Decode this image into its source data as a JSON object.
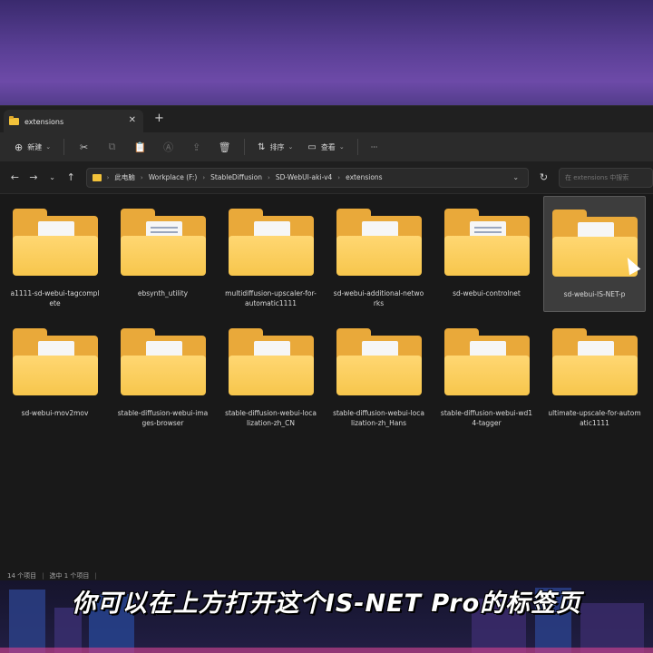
{
  "tab": {
    "title": "extensions",
    "close": "✕",
    "new": "+"
  },
  "toolbar": {
    "new_label": "新建",
    "sort_label": "排序",
    "view_label": "查看",
    "more": "···"
  },
  "address": {
    "crumbs": [
      "此电脑",
      "Workplace (F:)",
      "StableDiffusion",
      "SD-WebUI-aki-v4",
      "extensions"
    ],
    "search_placeholder": "在 extensions 中搜索"
  },
  "folders": [
    {
      "name": "a1111-sd-webui-tagcomplete",
      "line1": "a1111-sd-webui-tagcompl",
      "line2": "ete",
      "doc": false
    },
    {
      "name": "ebsynth_utility",
      "line1": "ebsynth_utility",
      "line2": "",
      "doc": true
    },
    {
      "name": "multidiffusion-upscaler-for-automatic1111",
      "line1": "multidiffusion-upscaler-for-",
      "line2": "automatic1111",
      "doc": false
    },
    {
      "name": "sd-webui-additional-networks",
      "line1": "sd-webui-additional-netwo",
      "line2": "rks",
      "doc": false
    },
    {
      "name": "sd-webui-controlnet",
      "line1": "sd-webui-controlnet",
      "line2": "",
      "doc": true
    },
    {
      "name": "sd-webui-IS-NET-pro",
      "line1": "sd-webui-IS-NET-p",
      "line2": "",
      "doc": false,
      "selected": true
    },
    {
      "name": "sd-webui-mov2mov",
      "line1": "sd-webui-mov2mov",
      "line2": "",
      "doc": false
    },
    {
      "name": "stable-diffusion-webui-images-browser",
      "line1": "stable-diffusion-webui-ima",
      "line2": "ges-browser",
      "doc": false
    },
    {
      "name": "stable-diffusion-webui-localization-zh_CN",
      "line1": "stable-diffusion-webui-loca",
      "line2": "lization-zh_CN",
      "doc": false
    },
    {
      "name": "stable-diffusion-webui-localization-zh_Hans",
      "line1": "stable-diffusion-webui-loca",
      "line2": "lization-zh_Hans",
      "doc": false
    },
    {
      "name": "stable-diffusion-webui-wd14-tagger",
      "line1": "stable-diffusion-webui-wd1",
      "line2": "4-tagger",
      "doc": false
    },
    {
      "name": "ultimate-upscale-for-automatic1111",
      "line1": "ultimate-upscale-for-autom",
      "line2": "atic1111",
      "doc": false
    }
  ],
  "status": {
    "count": "14 个项目",
    "selected": "选中 1 个项目"
  },
  "subtitle": "你可以在上方打开这个IS-NET Pro的标签页",
  "colors": {
    "folder_back": "#e9a93a",
    "folder_front": "#f7c64c",
    "window_bg": "#191919",
    "toolbar_bg": "#2b2b2b"
  }
}
